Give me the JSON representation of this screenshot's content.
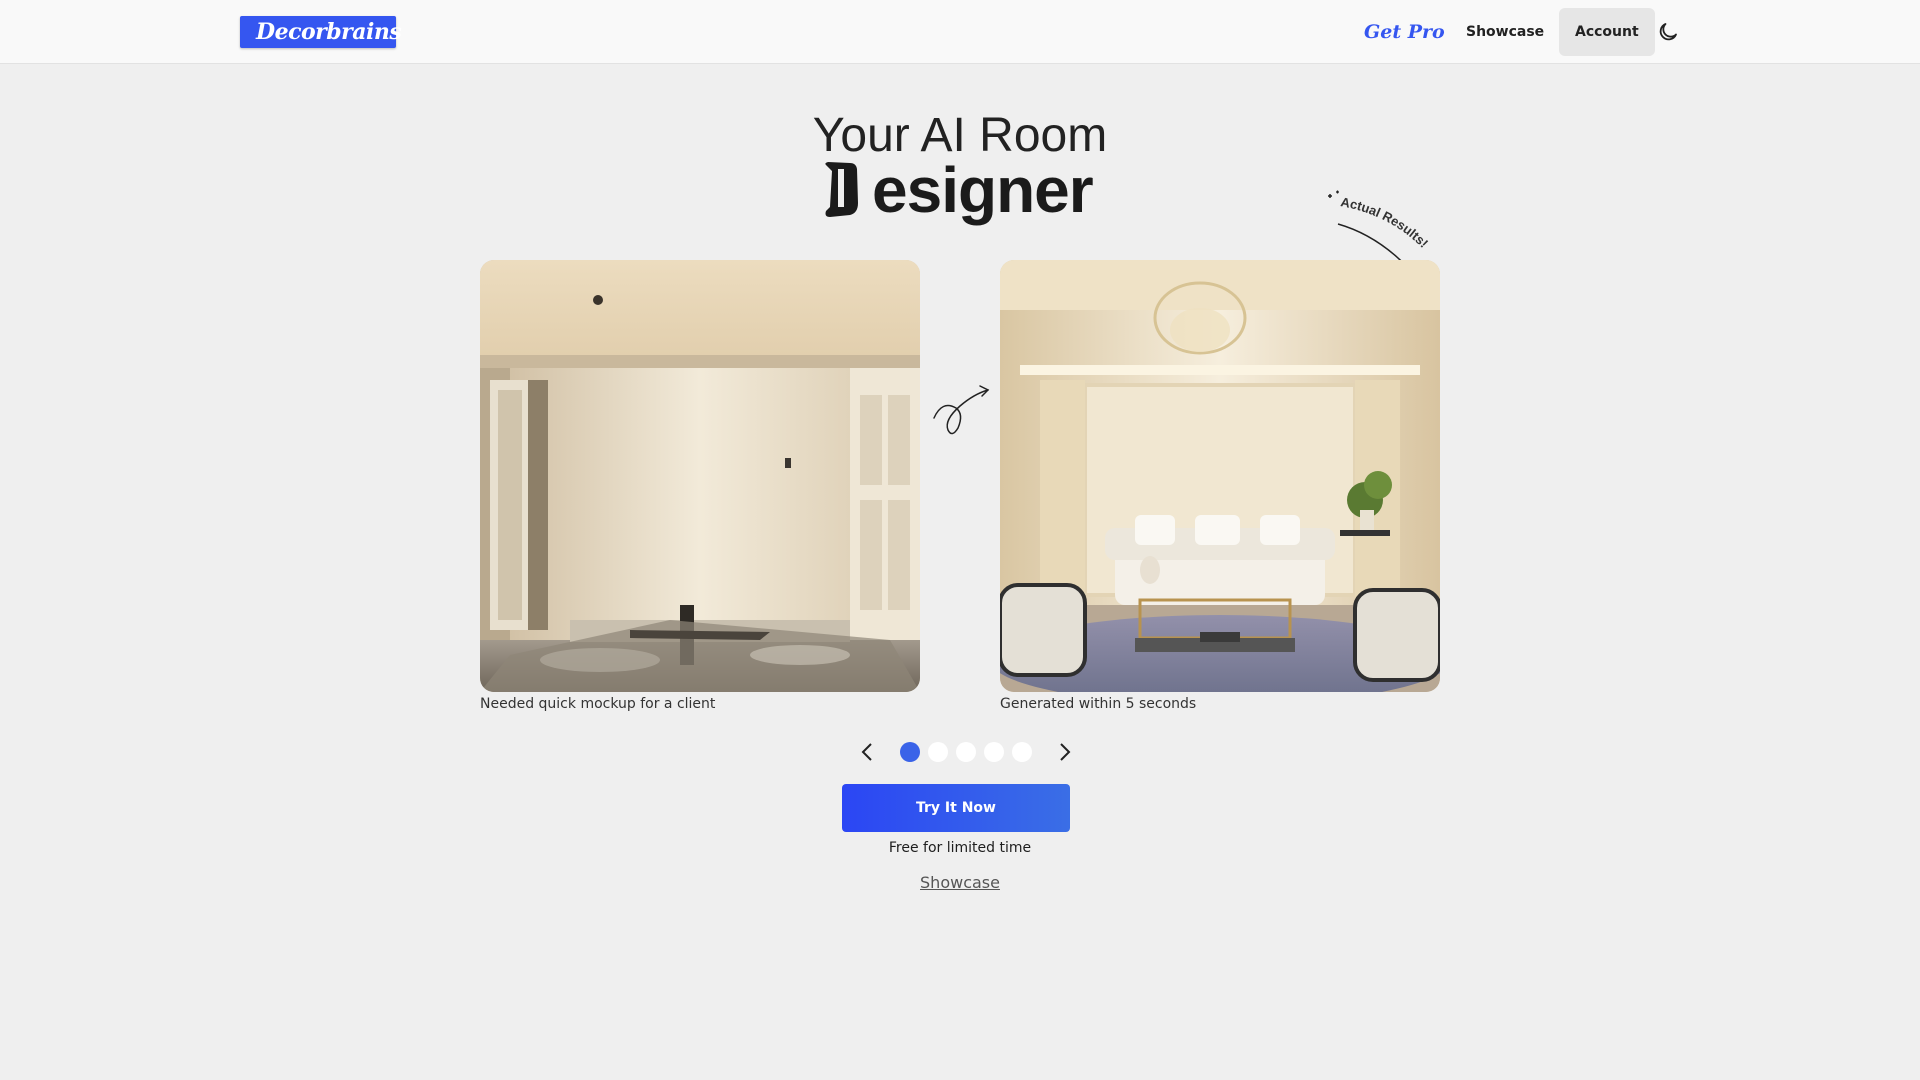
{
  "header": {
    "logo_text": "Decorbrains",
    "get_pro": "Get Pro",
    "nav_showcase": "Showcase",
    "nav_account": "Account",
    "theme_icon": "moon-icon"
  },
  "hero": {
    "line1": "Your AI Room",
    "line2": "esigner"
  },
  "gallery": {
    "before_caption": "Needed quick mockup for a client",
    "after_caption": "Generated within 5 seconds",
    "badge_text": "Actual Results!"
  },
  "carousel": {
    "dots": 5,
    "active_index": 0,
    "prev_icon": "chevron-left-icon",
    "next_icon": "chevron-right-icon"
  },
  "cta": {
    "button_label": "Try It Now",
    "note": "Free for limited time",
    "showcase_link": "Showcase"
  },
  "colors": {
    "accent": "#3556f0",
    "background": "#efefef",
    "active_dot": "#3a63e8"
  }
}
